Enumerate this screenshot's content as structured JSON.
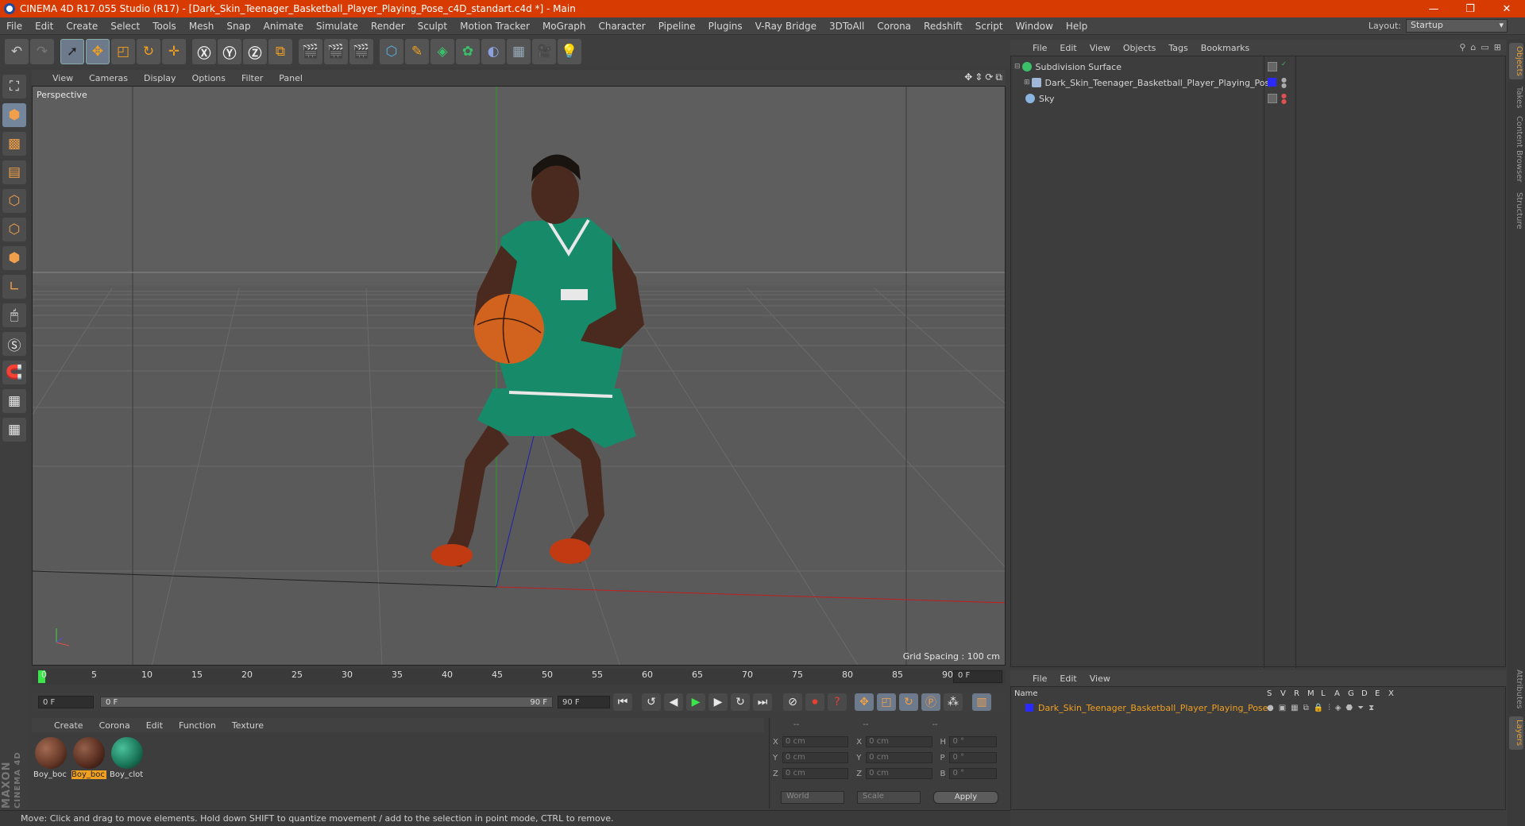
{
  "window": {
    "title": "CINEMA 4D R17.055 Studio (R17) - [Dark_Skin_Teenager_Basketball_Player_Playing_Pose_c4D_standart.c4d *] - Main"
  },
  "menubar": {
    "items": [
      "File",
      "Edit",
      "Create",
      "Select",
      "Tools",
      "Mesh",
      "Snap",
      "Animate",
      "Simulate",
      "Render",
      "Sculpt",
      "Motion Tracker",
      "MoGraph",
      "Character",
      "Pipeline",
      "Plugins",
      "V-Ray Bridge",
      "3DToAll",
      "Corona",
      "Redshift",
      "Script",
      "Window",
      "Help"
    ],
    "layout_label": "Layout:",
    "layout_value": "Startup"
  },
  "viewport": {
    "menu": [
      "View",
      "Cameras",
      "Display",
      "Options",
      "Filter",
      "Panel"
    ],
    "camera_label": "Perspective",
    "grid_spacing": "Grid Spacing : 100 cm"
  },
  "timeline": {
    "ticks": [
      "0",
      "5",
      "10",
      "15",
      "20",
      "25",
      "30",
      "35",
      "40",
      "45",
      "50",
      "55",
      "60",
      "65",
      "70",
      "75",
      "80",
      "85",
      "90"
    ],
    "current_frame": "0 F",
    "start_field": "0 F",
    "slider_start": "0 F",
    "slider_end": "90 F",
    "end_field": "90 F"
  },
  "material_manager": {
    "menu": [
      "Create",
      "Corona",
      "Edit",
      "Function",
      "Texture"
    ],
    "materials": [
      {
        "label": "Boy_boc",
        "selected": false,
        "color": "#6a3b2a"
      },
      {
        "label": "Boy_boc",
        "selected": true,
        "color": "#5a2f22"
      },
      {
        "label": "Boy_clot",
        "selected": false,
        "color": "#1c7a5c"
      }
    ]
  },
  "coordinates": {
    "headers": [
      "--",
      "--",
      "--"
    ],
    "rows": [
      {
        "a1": "X",
        "v1": "0 cm",
        "a2": "X",
        "v2": "0 cm",
        "a3": "H",
        "v3": "0 °"
      },
      {
        "a1": "Y",
        "v1": "0 cm",
        "a2": "Y",
        "v2": "0 cm",
        "a3": "P",
        "v3": "0 °"
      },
      {
        "a1": "Z",
        "v1": "0 cm",
        "a2": "Z",
        "v2": "0 cm",
        "a3": "B",
        "v3": "0 °"
      }
    ],
    "mode_world": "World",
    "mode_scale": "Scale",
    "apply": "Apply"
  },
  "status": "Move: Click and drag to move elements. Hold down SHIFT to quantize movement / add to the selection in point mode, CTRL to remove.",
  "object_manager": {
    "menu": [
      "File",
      "Edit",
      "View",
      "Objects",
      "Tags",
      "Bookmarks"
    ],
    "objects": [
      {
        "name": "Subdivision Surface",
        "icon_color": "#3bc06a"
      },
      {
        "name": "Dark_Skin_Teenager_Basketball_Player_Playing_Pose",
        "icon_color": "#9fb8d8"
      },
      {
        "name": "Sky",
        "icon_color": "#8cb4e0"
      }
    ]
  },
  "layer_manager": {
    "menu": [
      "File",
      "Edit",
      "View"
    ],
    "columns": [
      "Name",
      "S",
      "V",
      "R",
      "M",
      "L",
      "A",
      "G",
      "D",
      "E",
      "X"
    ],
    "layer_name": "Dark_Skin_Teenager_Basketball_Player_Playing_Pose"
  },
  "side_tabs": [
    "Objects",
    "Takes",
    "Content Browser",
    "Structure",
    "Attributes",
    "Layers"
  ],
  "logo": {
    "line1": "MAXON",
    "line2": "CINEMA 4D"
  },
  "colors": {
    "titlebar": "#d83b01",
    "accent": "#f0a020",
    "playhead": "#3be64a"
  }
}
